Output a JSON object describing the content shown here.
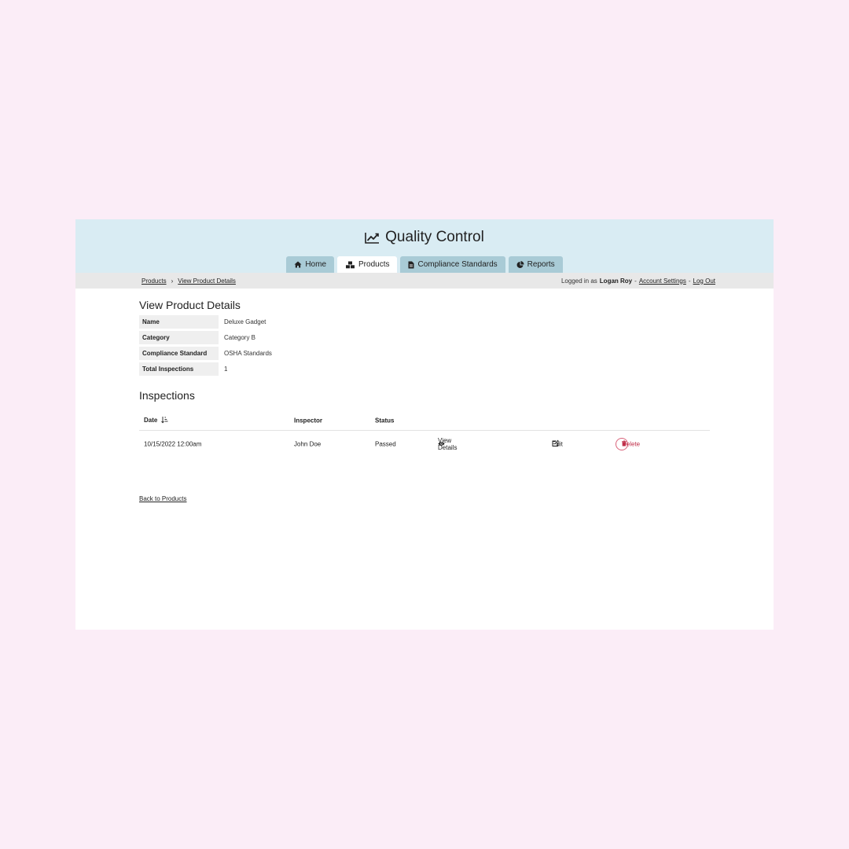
{
  "app": {
    "title": "Quality Control",
    "icon": "line-chart-icon"
  },
  "tabs": [
    {
      "label": "Home",
      "icon": "home-icon",
      "active": false
    },
    {
      "label": "Products",
      "icon": "cubes-icon",
      "active": true
    },
    {
      "label": "Compliance Standards",
      "icon": "document-icon",
      "active": false
    },
    {
      "label": "Reports",
      "icon": "pie-chart-icon",
      "active": false
    }
  ],
  "breadcrumb": {
    "items": [
      "Products",
      "View Product Details"
    ],
    "separator": "›"
  },
  "user": {
    "prefix": "Logged in as",
    "name": "Logan Roy",
    "sep": "-",
    "account_settings": "Account Settings",
    "logout": "Log Out"
  },
  "product": {
    "heading": "View Product Details",
    "fields": [
      {
        "label": "Name",
        "value": "Deluxe Gadget"
      },
      {
        "label": "Category",
        "value": "Category B"
      },
      {
        "label": "Compliance Standard",
        "value": "OSHA Standards"
      },
      {
        "label": "Total Inspections",
        "value": "1"
      }
    ]
  },
  "inspections": {
    "heading": "Inspections",
    "columns": {
      "date": "Date",
      "inspector": "Inspector",
      "status": "Status"
    },
    "rows": [
      {
        "date": "10/15/2022 12:00am",
        "inspector": "John Doe",
        "status": "Passed",
        "view_label": "View Details",
        "edit_label": "Edit",
        "delete_label": "Delete"
      }
    ]
  },
  "back_link": "Back to Products",
  "colors": {
    "page_bg": "#fbedf7",
    "header_bg": "#d9ecf3",
    "tab_bg": "#a9cbd6",
    "subbar_bg": "#e8e8e8",
    "delete_color": "#c0304a"
  }
}
